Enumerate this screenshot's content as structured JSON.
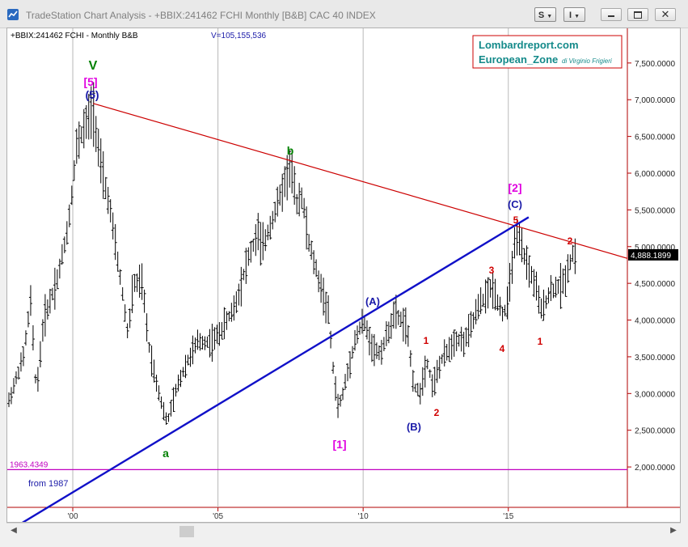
{
  "window": {
    "title": "TradeStation Chart Analysis - +BBIX:241462 FCHI Monthly [B&B] CAC 40 INDEX",
    "btn_s": "S",
    "btn_i": "I"
  },
  "chart": {
    "symbol_line": "+BBIX:241462 FCHI - Monthly  B&B",
    "volume_line": "V=105,155,536",
    "brand": {
      "line1": "Lombardreport.com",
      "line2": "European_Zone",
      "line2_small": "di Virginio Frigieri"
    },
    "last_price": "4,888.1899",
    "level_label": "1963.4349",
    "from_label": "from 1987",
    "colors": {
      "bars": "#000000",
      "trendline_red": "#cc0000",
      "channel_blue": "#1010c8",
      "level_line": "#c000c0",
      "label_green": "#008000",
      "label_magenta": "#e000e0",
      "label_blue": "#1a1aa8",
      "label_red": "#d00000"
    },
    "wave_labels": [
      {
        "text": "V",
        "color": "green"
      },
      {
        "text": "[5]",
        "color": "magenta"
      },
      {
        "text": "(5)",
        "color": "blue"
      },
      {
        "text": "b",
        "color": "green"
      },
      {
        "text": "a",
        "color": "green"
      },
      {
        "text": "[1]",
        "color": "magenta"
      },
      {
        "text": "(A)",
        "color": "blue"
      },
      {
        "text": "(B)",
        "color": "blue"
      },
      {
        "text": "1",
        "color": "red"
      },
      {
        "text": "2",
        "color": "red"
      },
      {
        "text": "3",
        "color": "red"
      },
      {
        "text": "4",
        "color": "red"
      },
      {
        "text": "5",
        "color": "red"
      },
      {
        "text": "(C)",
        "color": "blue"
      },
      {
        "text": "[2]",
        "color": "magenta"
      },
      {
        "text": "1",
        "color": "red"
      },
      {
        "text": "2",
        "color": "red"
      }
    ]
  },
  "chart_data": {
    "type": "ohlc",
    "title": "TradeStation Chart Analysis - +BBIX:241462 FCHI Monthly [B&B] CAC 40 INDEX",
    "x_ticks": [
      "'00",
      "'05",
      "'10",
      "'15"
    ],
    "y_ticks": [
      "2,000.0000",
      "2,500.0000",
      "3,000.0000",
      "3,500.0000",
      "4,000.0000",
      "4,500.0000",
      "5,000.0000",
      "5,500.0000",
      "6,000.0000",
      "6,500.0000",
      "7,000.0000",
      "7,500.0000"
    ],
    "ylim": [
      1450,
      7950
    ],
    "xlim": [
      1997.8,
      2019.1
    ],
    "anchors": [
      [
        1997.8,
        2900
      ],
      [
        1998.3,
        3500
      ],
      [
        1998.55,
        4250
      ],
      [
        1998.75,
        3000
      ],
      [
        1999.0,
        4000
      ],
      [
        1999.5,
        4600
      ],
      [
        1999.85,
        5300
      ],
      [
        2000.15,
        6400
      ],
      [
        2000.5,
        6700
      ],
      [
        2000.7,
        6900
      ],
      [
        2001.0,
        6000
      ],
      [
        2001.25,
        5600
      ],
      [
        2001.7,
        4400
      ],
      [
        2001.9,
        3800
      ],
      [
        2002.1,
        4500
      ],
      [
        2002.4,
        4500
      ],
      [
        2002.6,
        3700
      ],
      [
        2002.8,
        3300
      ],
      [
        2003.1,
        2800
      ],
      [
        2003.25,
        2600
      ],
      [
        2003.6,
        3100
      ],
      [
        2003.9,
        3400
      ],
      [
        2004.3,
        3700
      ],
      [
        2004.8,
        3700
      ],
      [
        2005.1,
        3850
      ],
      [
        2005.6,
        4200
      ],
      [
        2006.0,
        4800
      ],
      [
        2006.4,
        5200
      ],
      [
        2006.5,
        4950
      ],
      [
        2006.9,
        5400
      ],
      [
        2007.4,
        6000
      ],
      [
        2007.5,
        6100
      ],
      [
        2007.7,
        5600
      ],
      [
        2007.9,
        5700
      ],
      [
        2008.1,
        5100
      ],
      [
        2008.5,
        4500
      ],
      [
        2008.8,
        4100
      ],
      [
        2009.0,
        3200
      ],
      [
        2009.15,
        2800
      ],
      [
        2009.3,
        3000
      ],
      [
        2009.7,
        3700
      ],
      [
        2010.0,
        4000
      ],
      [
        2010.35,
        3600
      ],
      [
        2010.6,
        3550
      ],
      [
        2011.1,
        4100
      ],
      [
        2011.5,
        3900
      ],
      [
        2011.75,
        3100
      ],
      [
        2011.95,
        3000
      ],
      [
        2012.2,
        3450
      ],
      [
        2012.4,
        3100
      ],
      [
        2012.7,
        3450
      ],
      [
        2013.2,
        3750
      ],
      [
        2013.5,
        3700
      ],
      [
        2014.0,
        4200
      ],
      [
        2014.45,
        4450
      ],
      [
        2014.8,
        4100
      ],
      [
        2014.95,
        4150
      ],
      [
        2015.2,
        5000
      ],
      [
        2015.35,
        5100
      ],
      [
        2015.7,
        4700
      ],
      [
        2016.0,
        4400
      ],
      [
        2016.1,
        4100
      ],
      [
        2016.45,
        4400
      ],
      [
        2016.9,
        4500
      ],
      [
        2017.2,
        4900
      ],
      [
        2017.3,
        4888.19
      ]
    ],
    "trend_red": [
      [
        2000.7,
        6950
      ],
      [
        2019.1,
        4840
      ]
    ],
    "channel_blue": [
      [
        1997.8,
        1130
      ],
      [
        2015.7,
        5400
      ]
    ],
    "level_line": 1963.43,
    "last_price": 4888.19,
    "grid": false
  }
}
